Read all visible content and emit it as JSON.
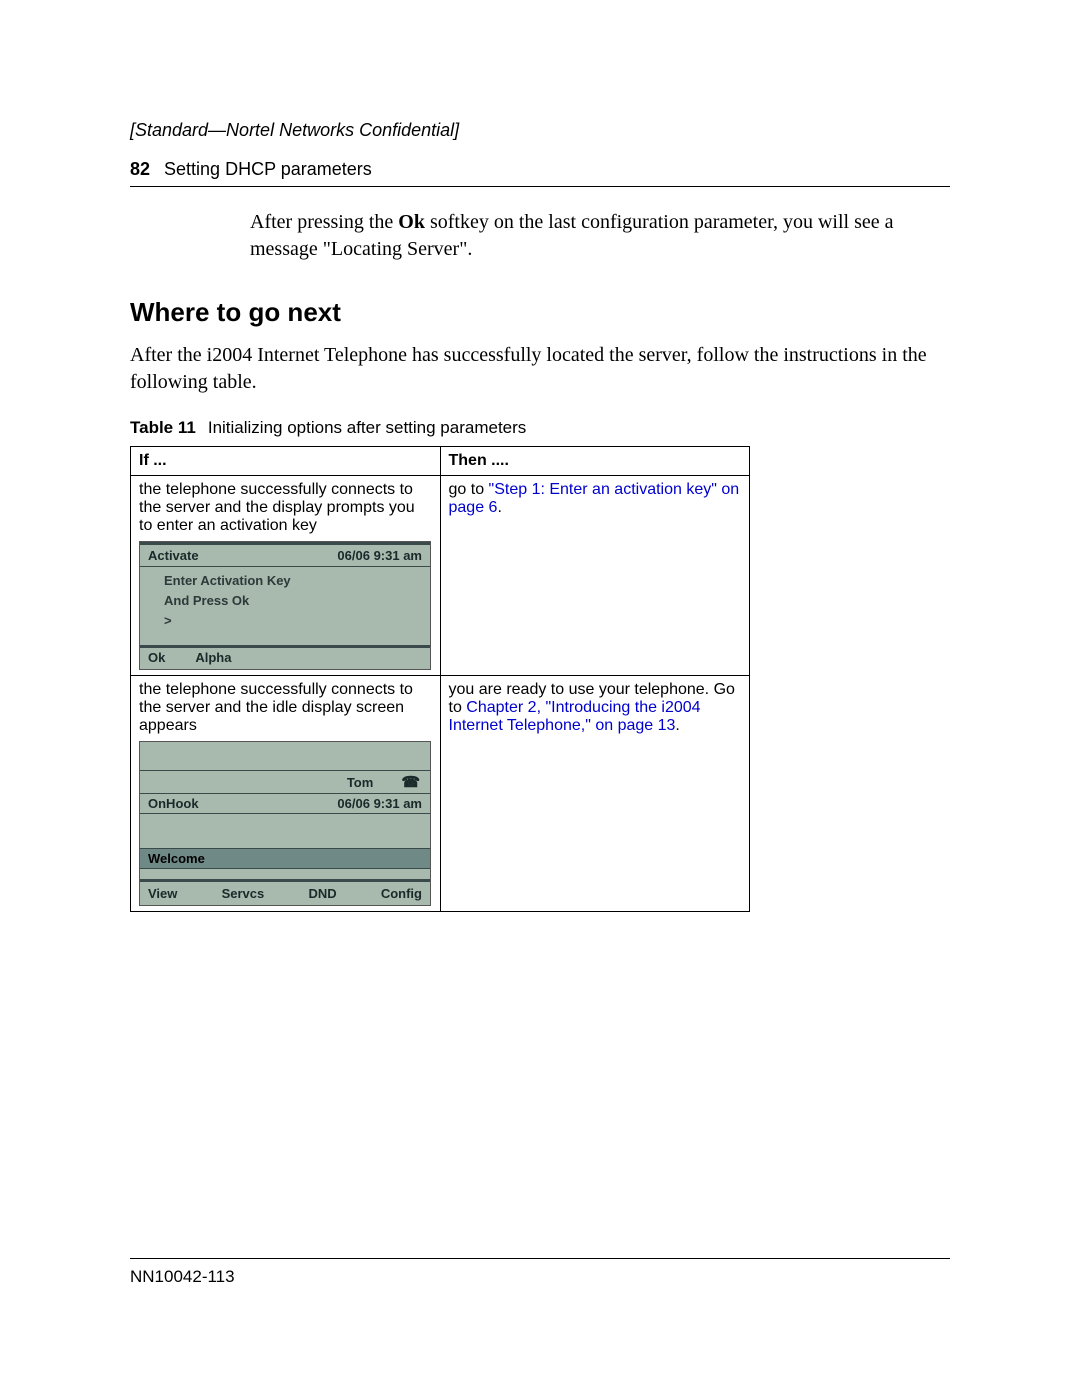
{
  "header": {
    "confidential": "[Standard—Nortel Networks Confidential]",
    "page_num": "82",
    "section": "Setting DHCP parameters"
  },
  "intro": {
    "before_bold": "After pressing the ",
    "bold": "Ok",
    "after_bold": " softkey on the last configuration parameter, you will see a message \"Locating Server\"."
  },
  "h2": "Where to go next",
  "after_h2": "After the i2004 Internet Telephone has successfully located the server, follow the instructions in the following table.",
  "table": {
    "caption_label": "Table 11",
    "caption_text": "Initializing options after setting parameters",
    "head_if": "If ...",
    "head_then": "Then ....",
    "row1": {
      "if_text": "the telephone successfully connects to the server and the display prompts you to enter an activation key",
      "then_pre": "go to ",
      "then_link": "\"Step 1: Enter an activation key\" on page 6",
      "then_post": "."
    },
    "row2": {
      "if_text": "the telephone successfully connects to the server and the idle display screen appears",
      "then_pre": "you are ready to use your telephone. Go to ",
      "then_link": "Chapter 2, \"Introducing the i2004 Internet Telephone,\" on page 13",
      "then_post": "."
    }
  },
  "phone1": {
    "title": "Activate",
    "datetime": "06/06    9:31 am",
    "line1": "Enter Activation Key",
    "line2": "And Press Ok",
    "line3": ">",
    "sk1": "Ok",
    "sk2": "Alpha"
  },
  "phone2": {
    "name": "Tom",
    "status": "OnHook",
    "datetime": "06/06   9:31 am",
    "welcome": "Welcome",
    "sk1": "View",
    "sk2": "Servcs",
    "sk3": "DND",
    "sk4": "Config"
  },
  "footer": {
    "doc_id": "NN10042-113"
  }
}
